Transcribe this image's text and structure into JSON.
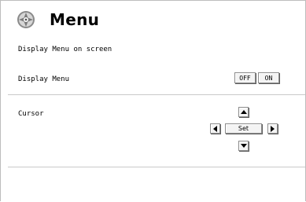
{
  "header": {
    "title": "Menu",
    "logo_icon": "projector-logo-icon"
  },
  "subtitle": "Display Menu on screen",
  "display_menu": {
    "label": "Display Menu",
    "off_label": "OFF",
    "on_label": "ON"
  },
  "cursor": {
    "label": "Cursor",
    "set_label": "Set",
    "up_icon": "triangle-up-icon",
    "down_icon": "triangle-down-icon",
    "left_icon": "triangle-left-icon",
    "right_icon": "triangle-right-icon"
  },
  "colors": {
    "divider": "#c9c9c9",
    "button_face": "#f4f4f4",
    "border": "#bdbdbd"
  }
}
